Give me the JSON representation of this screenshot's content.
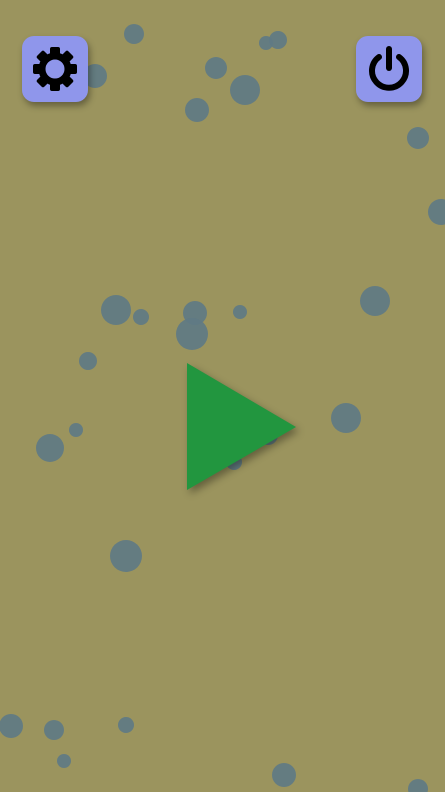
{
  "theme": {
    "background": "#9b945e",
    "bubble_color": "#5f7a84",
    "button_color": "#8f96eb",
    "icon_color": "#000000",
    "play_color": "#22963f"
  },
  "toolbar": {
    "settings": {
      "icon": "gear-icon"
    },
    "power": {
      "icon": "power-icon"
    }
  },
  "play": {
    "icon": "play-icon"
  }
}
